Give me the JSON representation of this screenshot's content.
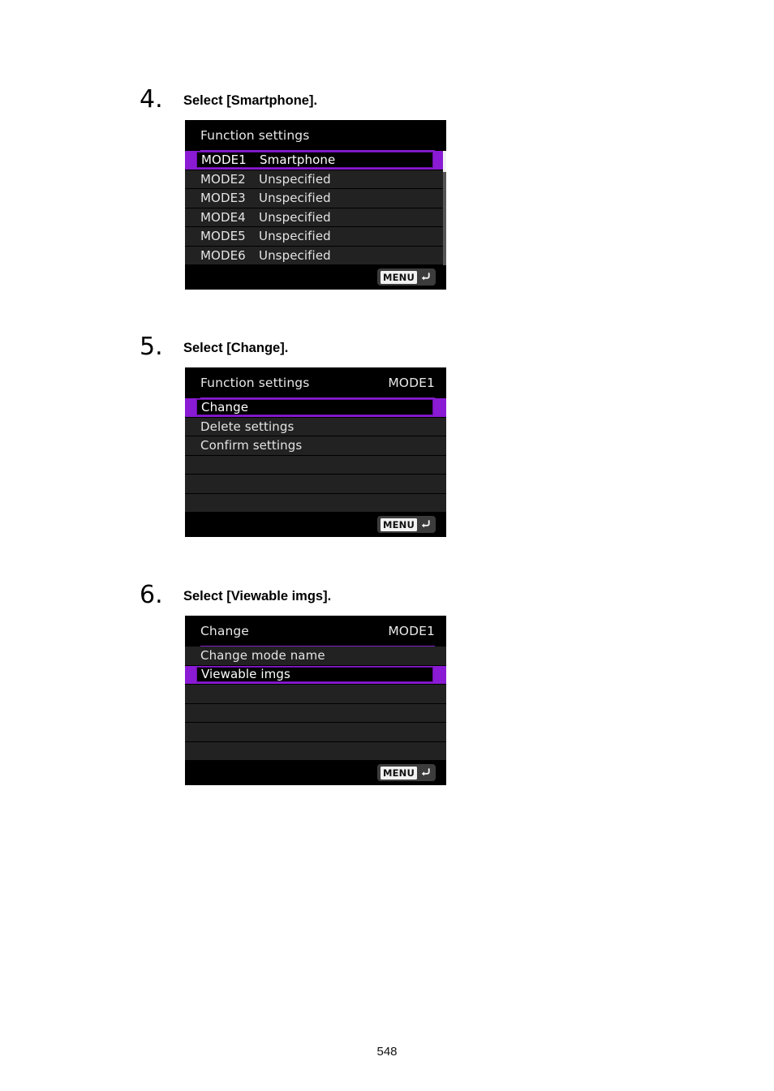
{
  "document": {
    "page_number": "548"
  },
  "accent": {
    "purple": "#8a1ad4",
    "purple_rule": "#8020c8",
    "purple_border": "#6a10a8",
    "row_bg": "#222222",
    "screen_bg": "#000000",
    "text": "#e4e4e4"
  },
  "steps": [
    {
      "number": "4.",
      "title": "Select [Smartphone].",
      "screen": {
        "title_left": "Function settings",
        "title_right": "",
        "menu_button": "MENU",
        "scrollbar": true,
        "rows": [
          {
            "mode": "MODE1",
            "value": "Smartphone",
            "selected": true
          },
          {
            "mode": "MODE2",
            "value": "Unspecified",
            "selected": false
          },
          {
            "mode": "MODE3",
            "value": "Unspecified",
            "selected": false
          },
          {
            "mode": "MODE4",
            "value": "Unspecified",
            "selected": false
          },
          {
            "mode": "MODE5",
            "value": "Unspecified",
            "selected": false
          },
          {
            "mode": "MODE6",
            "value": "Unspecified",
            "selected": false
          }
        ]
      }
    },
    {
      "number": "5.",
      "title": "Select [Change].",
      "screen": {
        "title_left": "Function settings",
        "title_right": "MODE1",
        "menu_button": "MENU",
        "scrollbar": false,
        "rows": [
          {
            "mode": "",
            "value": "Change",
            "selected": true
          },
          {
            "mode": "",
            "value": "Delete settings",
            "selected": false
          },
          {
            "mode": "",
            "value": "Confirm settings",
            "selected": false
          },
          {
            "mode": "",
            "value": "",
            "selected": false
          },
          {
            "mode": "",
            "value": "",
            "selected": false
          },
          {
            "mode": "",
            "value": "",
            "selected": false
          }
        ]
      }
    },
    {
      "number": "6.",
      "title": "Select [Viewable imgs].",
      "screen": {
        "title_left": "Change",
        "title_right": "MODE1",
        "menu_button": "MENU",
        "scrollbar": false,
        "rows": [
          {
            "mode": "",
            "value": "Change mode name",
            "selected": false
          },
          {
            "mode": "",
            "value": "Viewable imgs",
            "selected": true
          },
          {
            "mode": "",
            "value": "",
            "selected": false
          },
          {
            "mode": "",
            "value": "",
            "selected": false
          },
          {
            "mode": "",
            "value": "",
            "selected": false
          },
          {
            "mode": "",
            "value": "",
            "selected": false
          }
        ]
      }
    }
  ]
}
